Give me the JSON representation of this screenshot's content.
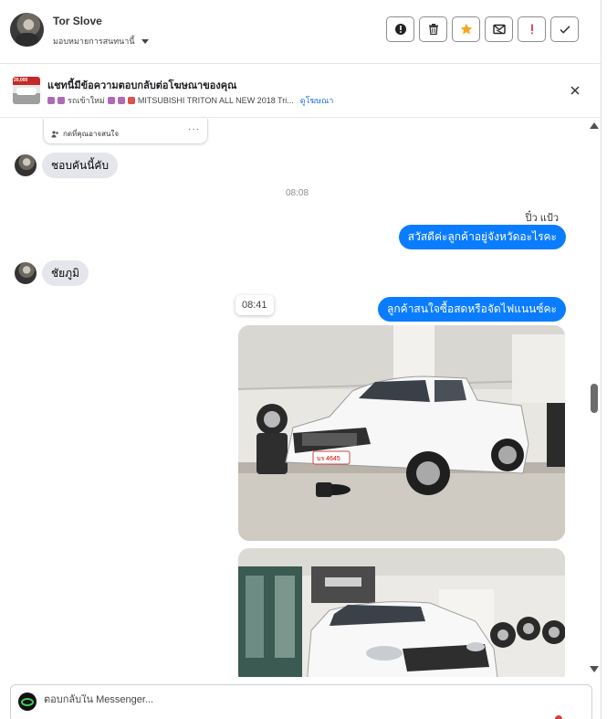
{
  "header": {
    "contact_name": "Tor Slove",
    "assign_label": "มอบหมายการสนทนานี้",
    "actions": [
      "mark-spam",
      "delete",
      "star",
      "mark-unread",
      "follow-up",
      "done"
    ]
  },
  "ad_banner": {
    "thumb_label": "20,000",
    "title": "แชทนี้มีข้อความตอบกลับต่อโฆษณาของคุณ",
    "subtitle_prefix": "รถเข้าใหม่",
    "subtitle_text": "MITSUBISHI TRITON ALL NEW 2018 Tri...",
    "view_ad_link": "ดูโฆษณา"
  },
  "chat": {
    "card_stub_text": "กดที่คุณอาจสนใจ",
    "card_stub_more": "···",
    "messages": [
      {
        "from": "customer",
        "text": "ชอบคันนี้คับ"
      },
      {
        "time": "08:08"
      },
      {
        "sender": "ปิ๋ว แป้ว"
      },
      {
        "from": "page",
        "text": "สวัสดีค่ะลูกค้าอยู่จังหวัดอะไรคะ"
      },
      {
        "from": "customer",
        "text": "ชัยภูมิ"
      },
      {
        "time_chip": "08:41"
      },
      {
        "from": "page",
        "text": "ลูกค้าสนใจซื้อสดหรือจัดไฟแนนซ์คะ"
      }
    ],
    "photo_plate": "บร 4645"
  },
  "composer": {
    "placeholder": "ตอบกลับใน Messenger..."
  },
  "colors": {
    "accent_blue": "#0a7cff",
    "incoming_bubble": "#e4e6eb",
    "star_orange": "#f5a623",
    "alert_red": "#e03a3a"
  }
}
